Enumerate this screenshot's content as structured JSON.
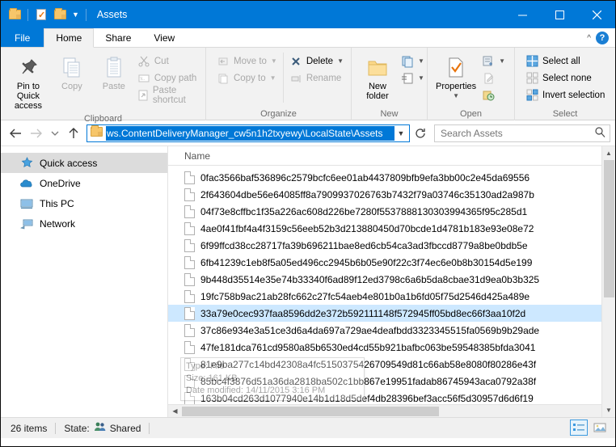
{
  "window": {
    "title": "Assets",
    "quick_access_icons": [
      "folder-icon",
      "properties-check-icon",
      "folder-icon",
      "chevron-down-icon"
    ],
    "controls": {
      "minimize": "minimize-icon",
      "maximize": "maximize-icon",
      "close": "close-icon"
    }
  },
  "tabs": [
    {
      "label": "File",
      "kind": "file"
    },
    {
      "label": "Home",
      "kind": "active"
    },
    {
      "label": "Share",
      "kind": "normal"
    },
    {
      "label": "View",
      "kind": "normal"
    }
  ],
  "tab_right": {
    "collapse": "chevron-up-icon",
    "help": "?"
  },
  "ribbon": {
    "groups": [
      {
        "label": "Clipboard",
        "big": [
          {
            "label1": "Pin to Quick",
            "label2": "access",
            "icon": "pin-icon",
            "dim": false
          },
          {
            "label1": "Copy",
            "label2": "",
            "icon": "copy-icon",
            "dim": true
          },
          {
            "label1": "Paste",
            "label2": "",
            "icon": "paste-icon",
            "dim": true
          }
        ],
        "small": [
          {
            "label": "Cut",
            "icon": "scissors-icon",
            "dim": true
          },
          {
            "label": "Copy path",
            "icon": "copy-path-icon",
            "dim": true
          },
          {
            "label": "Paste shortcut",
            "icon": "paste-shortcut-icon",
            "dim": true
          }
        ]
      },
      {
        "label": "Organize",
        "small_a": [
          {
            "label": "Move to",
            "icon": "move-to-icon",
            "dim": true,
            "caret": true
          },
          {
            "label": "Copy to",
            "icon": "copy-to-icon",
            "dim": true,
            "caret": true
          }
        ],
        "small_b": [
          {
            "label": "Delete",
            "icon": "delete-x-icon",
            "dim": false,
            "caret": true
          },
          {
            "label": "Rename",
            "icon": "rename-icon",
            "dim": true,
            "caret": false
          }
        ]
      },
      {
        "label": "New",
        "big": [
          {
            "label1": "New",
            "label2": "folder",
            "icon": "new-folder-icon",
            "dim": false
          }
        ],
        "small": [
          {
            "label": "",
            "icon": "new-item-icon",
            "dim": false,
            "caret": true
          },
          {
            "label": "",
            "icon": "easy-access-icon",
            "dim": false,
            "caret": true
          }
        ]
      },
      {
        "label": "Open",
        "big": [
          {
            "label1": "Properties",
            "label2": "",
            "icon": "properties-icon",
            "dim": false,
            "caret": true
          }
        ],
        "small": [
          {
            "label": "",
            "icon": "open-with-icon",
            "dim": false,
            "caret": true
          },
          {
            "label": "",
            "icon": "edit-icon",
            "dim": true,
            "caret": false
          },
          {
            "label": "",
            "icon": "history-icon",
            "dim": false,
            "caret": false
          }
        ]
      },
      {
        "label": "Select",
        "small": [
          {
            "label": "Select all",
            "icon": "select-all-icon",
            "dim": false
          },
          {
            "label": "Select none",
            "icon": "select-none-icon",
            "dim": false
          },
          {
            "label": "Invert selection",
            "icon": "invert-selection-icon",
            "dim": false
          }
        ]
      }
    ]
  },
  "address": {
    "back": "back-arrow-icon",
    "forward": "forward-arrow-icon",
    "recent": "chevron-down-icon",
    "up": "up-arrow-icon",
    "folder_icon": "folder-icon",
    "path_text": "ws.ContentDeliveryManager_cw5n1h2txyewy\\LocalState\\Assets",
    "dropdown": "chevron-down-icon",
    "refresh": "refresh-icon"
  },
  "search": {
    "placeholder": "Search Assets",
    "icon": "search-icon",
    "value": ""
  },
  "sidebar": {
    "items": [
      {
        "label": "Quick access",
        "icon": "star-pin-icon",
        "selected": true
      },
      {
        "label": "OneDrive",
        "icon": "onedrive-cloud-icon",
        "selected": false
      },
      {
        "label": "This PC",
        "icon": "monitor-icon",
        "selected": false
      },
      {
        "label": "Network",
        "icon": "network-icon",
        "selected": false
      }
    ]
  },
  "filelist": {
    "column_header": "Name",
    "rows": [
      {
        "name": "0fac3566baf536896c2579bcfc6ee01ab4437809bfb9efa3bb00c2e45da69556",
        "selected": false
      },
      {
        "name": "2f643604dbe56e64085ff8a7909937026763b7432f79a03746c35130ad2a987b",
        "selected": false
      },
      {
        "name": "04f73e8cffbc1f35a226ac608d226be7280f5537888130303994365f95c285d1",
        "selected": false
      },
      {
        "name": "4ae0f41fbf4a4f3159c56eeb52b3d213880450d70bcde1d4781b183e93e08e72",
        "selected": false
      },
      {
        "name": "6f99ffcd38cc28717fa39b696211bae8ed6cb54ca3ad3fbccd8779a8be0bdb5e",
        "selected": false
      },
      {
        "name": "6fb41239c1eb8f5a05ed496cc2945b6b05e90f22c3f74ec6e0b8b30154d5e199",
        "selected": false
      },
      {
        "name": "9b448d35514e35e74b33340f6ad89f12ed3798c6a6b5da8cbae31d9ea0b3b325",
        "selected": false
      },
      {
        "name": "19fc758b9ac21ab28fc662c27fc54aeb4e801b0a1b6fd05f75d2546d425a489e",
        "selected": false
      },
      {
        "name": "33a79e0cec937faa8596dd2e372b592111148f572945ff05bd8ec66f3aa10f2d",
        "selected": true
      },
      {
        "name": "37c86e934e3a51ce3d6a4da697a729ae4deafbdd3323345515fa0569b9b29ade",
        "selected": false
      },
      {
        "name": "47fe181dca761cd9580a85b6530ed4cd55b921bafbc063be59548385bfda3041",
        "selected": false
      },
      {
        "name": "81e9ba277c14bd42308a4fc5150375426709549d81c66ab58e8080f80286e43f",
        "selected": false
      },
      {
        "name": "85bc4f3876d51a36da2818ba502c1bb867e19951fadab86745943aca0792a38f",
        "selected": false
      },
      {
        "name": "163b04cd263d1077940e14b1d18d5def4db28396bef3acc56f5d30957d6d6f19",
        "selected": false
      }
    ]
  },
  "tooltip": {
    "type_line": "Type: File",
    "size_line": "Size: 161 KB",
    "date_line": "Date modified: 14/11/2015 3:16 PM"
  },
  "status": {
    "item_count": "26 items",
    "state_label": "State:",
    "state_value": "Shared",
    "state_icon": "shared-people-icon",
    "view_details": "details-view-icon",
    "view_large": "large-icons-view-icon"
  },
  "colors": {
    "accent": "#0078d7",
    "selection": "#cde8ff",
    "ribbon_bg": "#f2f2f2",
    "status_bg": "#f0f0f0"
  }
}
